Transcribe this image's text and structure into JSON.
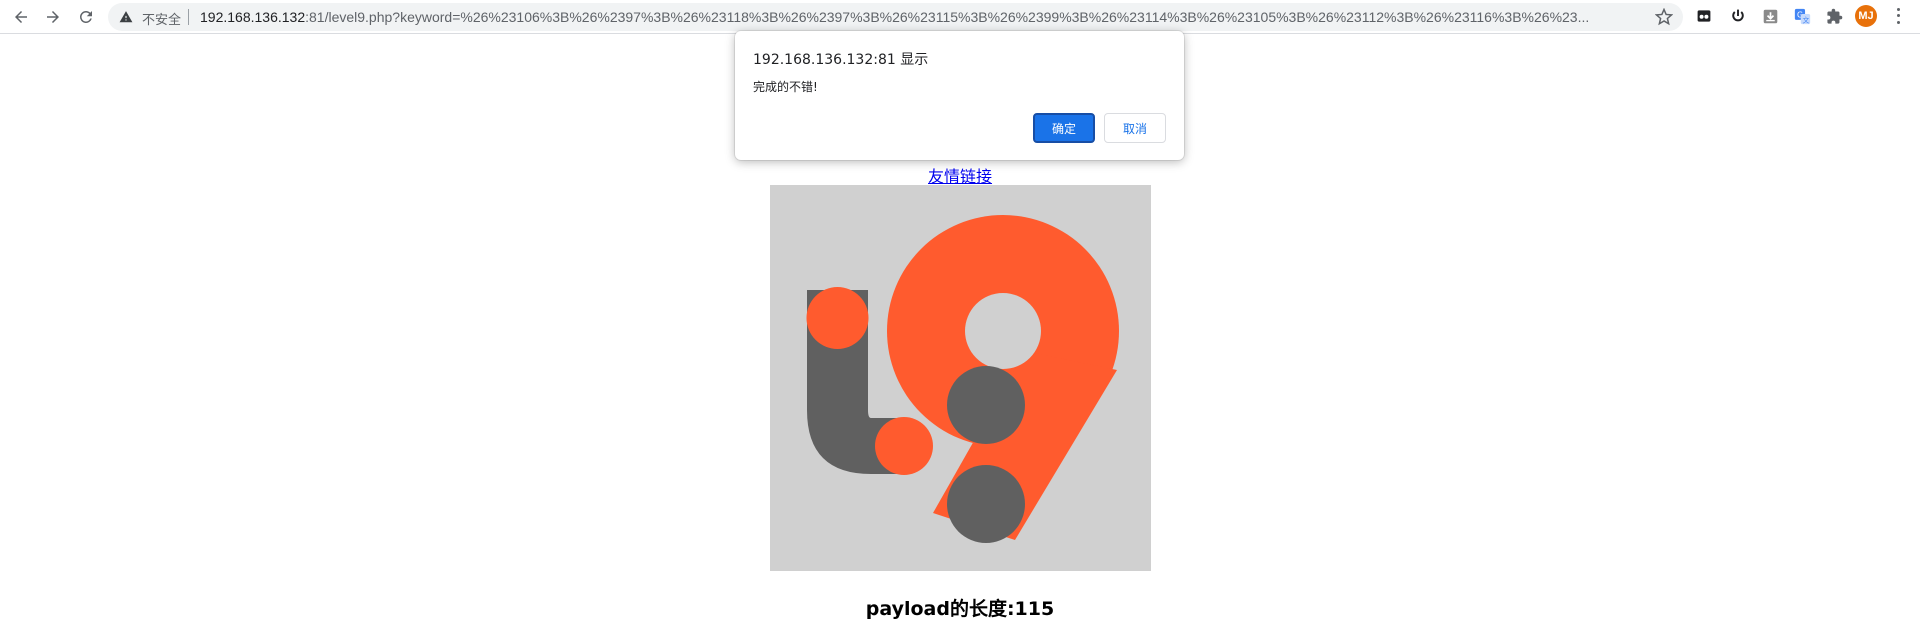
{
  "browser": {
    "url_host": "192.168.136.132",
    "url_rest": ":81/level9.php?keyword=%26%23106%3B%26%2397%3B%26%23118%3B%26%2397%3B%26%23115%3B%26%2399%3B%26%23114%3B%26%23105%3B%26%23112%3B%26%23116%3B%26%23...",
    "security_label": "不安全",
    "avatar_initials": "MJ",
    "icons": {
      "back": "arrow-left-icon",
      "forward": "arrow-right-icon",
      "reload": "reload-icon",
      "warning": "warning-icon",
      "bookmark": "star-icon",
      "extensions": [
        "tab-search-icon",
        "power-icon",
        "download-icon",
        "translate-icon",
        "puzzle-icon"
      ],
      "menu": "more-vert-icon"
    }
  },
  "dialog": {
    "title": "192.168.136.132:81 显示",
    "message": "完成的不错!",
    "ok_label": "确定",
    "cancel_label": "取消"
  },
  "page": {
    "friend_link": "友情链接",
    "payload_text": "payload的长度:115"
  },
  "logo": {
    "background_color": "#d0d0d0",
    "accent_color": "#ff5b2e",
    "dark_color": "#606060"
  }
}
